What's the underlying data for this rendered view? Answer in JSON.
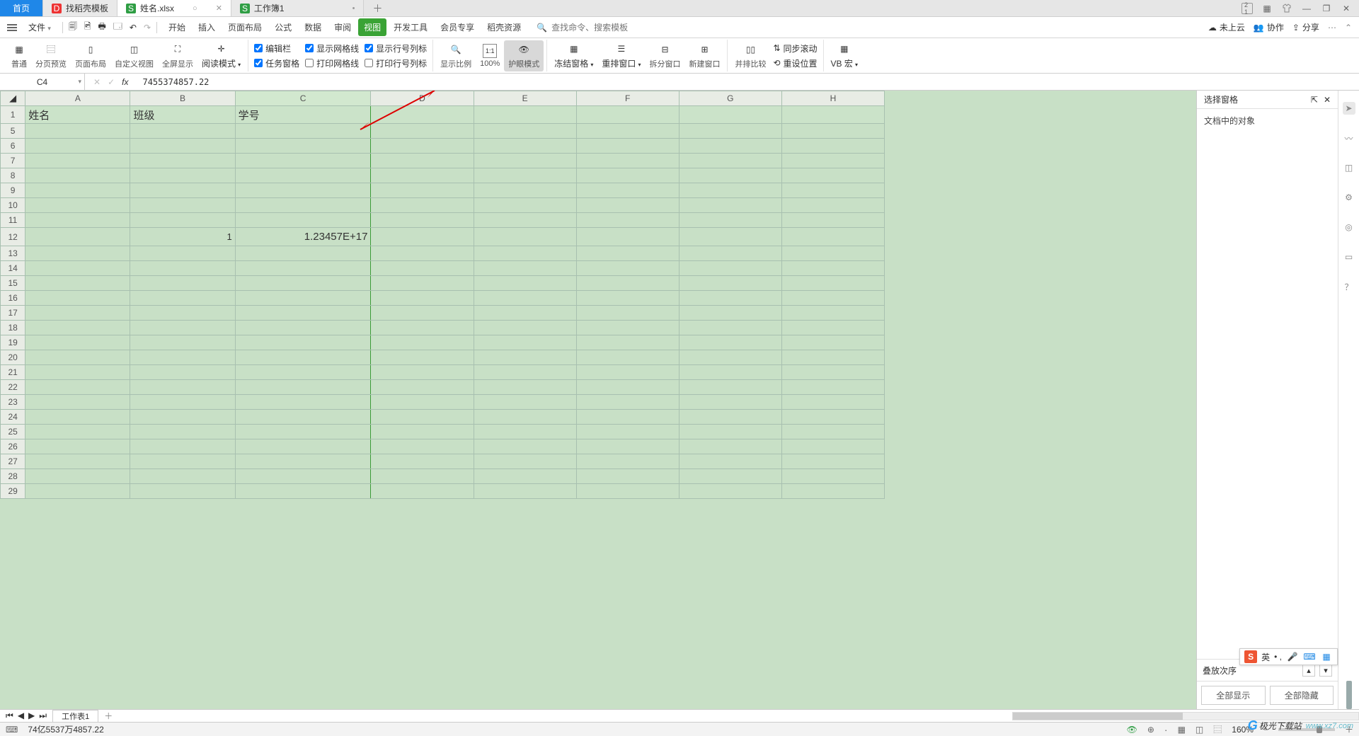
{
  "tabs": {
    "home": "首页",
    "t1": "找稻壳模板",
    "t2": "姓名.xlsx",
    "t3": "工作簿1"
  },
  "menu": {
    "file": "文件",
    "items": [
      "开始",
      "插入",
      "页面布局",
      "公式",
      "数据",
      "审阅",
      "视图",
      "开发工具",
      "会员专享",
      "稻壳资源"
    ],
    "search_ph": "查找命令、搜索模板",
    "right": {
      "cloud": "未上云",
      "coop": "协作",
      "share": "分享"
    }
  },
  "ribbon": {
    "g1": [
      "普通",
      "分页预览",
      "页面布局",
      "自定义视图",
      "全屏显示",
      "阅读模式"
    ],
    "g2": {
      "editbar": "编辑栏",
      "gridline": "显示网格线",
      "rowcol": "显示行号列标",
      "taskpane": "任务窗格",
      "printgrid": "打印网格线",
      "printrowcol": "打印行号列标"
    },
    "g3": [
      "显示比例",
      "100%",
      "护眼模式"
    ],
    "g4": [
      "冻结窗格",
      "重排窗口",
      "拆分窗口",
      "新建窗口"
    ],
    "g5": [
      "并排比较"
    ],
    "g5b": [
      "同步滚动",
      "重设位置"
    ],
    "g6": "VB 宏"
  },
  "formula": {
    "cell": "C4",
    "fx": "7455374857.22"
  },
  "cols": [
    "A",
    "B",
    "C",
    "D",
    "E",
    "F",
    "G",
    "H"
  ],
  "rows": [
    "1",
    "5",
    "6",
    "7",
    "8",
    "9",
    "10",
    "11",
    "12",
    "13",
    "14",
    "15",
    "16",
    "17",
    "18",
    "19",
    "20",
    "21",
    "22",
    "23",
    "24",
    "25",
    "26",
    "27",
    "28",
    "29"
  ],
  "headers": {
    "A1": "姓名",
    "B1": "班级",
    "C1": "学号"
  },
  "cells": {
    "B12": "1",
    "C12": "1.23457E+17"
  },
  "panel": {
    "title": "选择窗格",
    "sub": "文档中的对象",
    "order": "叠放次序",
    "showAll": "全部显示",
    "hideAll": "全部隐藏"
  },
  "sheet": {
    "name": "工作表1"
  },
  "status": {
    "sum": "74亿5537万4857.22",
    "zoom": "160%"
  },
  "ime": {
    "lang": "英"
  },
  "watermark": {
    "brand": "极光下载站",
    "url": "www.xz7.com"
  }
}
